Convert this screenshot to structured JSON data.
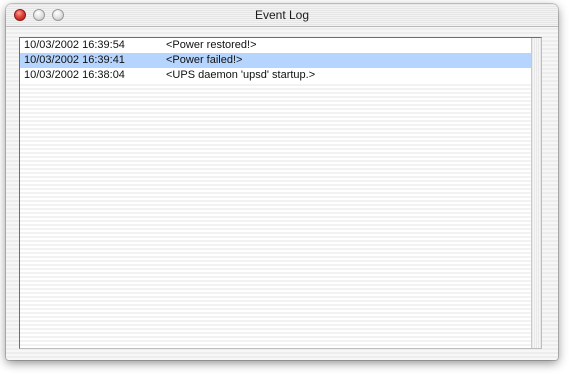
{
  "window": {
    "title": "Event Log"
  },
  "log": {
    "entries": [
      {
        "timestamp": "10/03/2002 16:39:54",
        "message": "<Power restored!>",
        "selected": false
      },
      {
        "timestamp": "10/03/2002 16:39:41",
        "message": "<Power failed!>",
        "selected": true
      },
      {
        "timestamp": "10/03/2002 16:38:04",
        "message": "<UPS daemon 'upsd' startup.>",
        "selected": false
      }
    ]
  },
  "colors": {
    "selection": "#b5d5ff",
    "close_button": "#e0443a"
  },
  "icons": {
    "close": "close-icon",
    "minimize": "minimize-icon",
    "zoom": "zoom-icon"
  }
}
